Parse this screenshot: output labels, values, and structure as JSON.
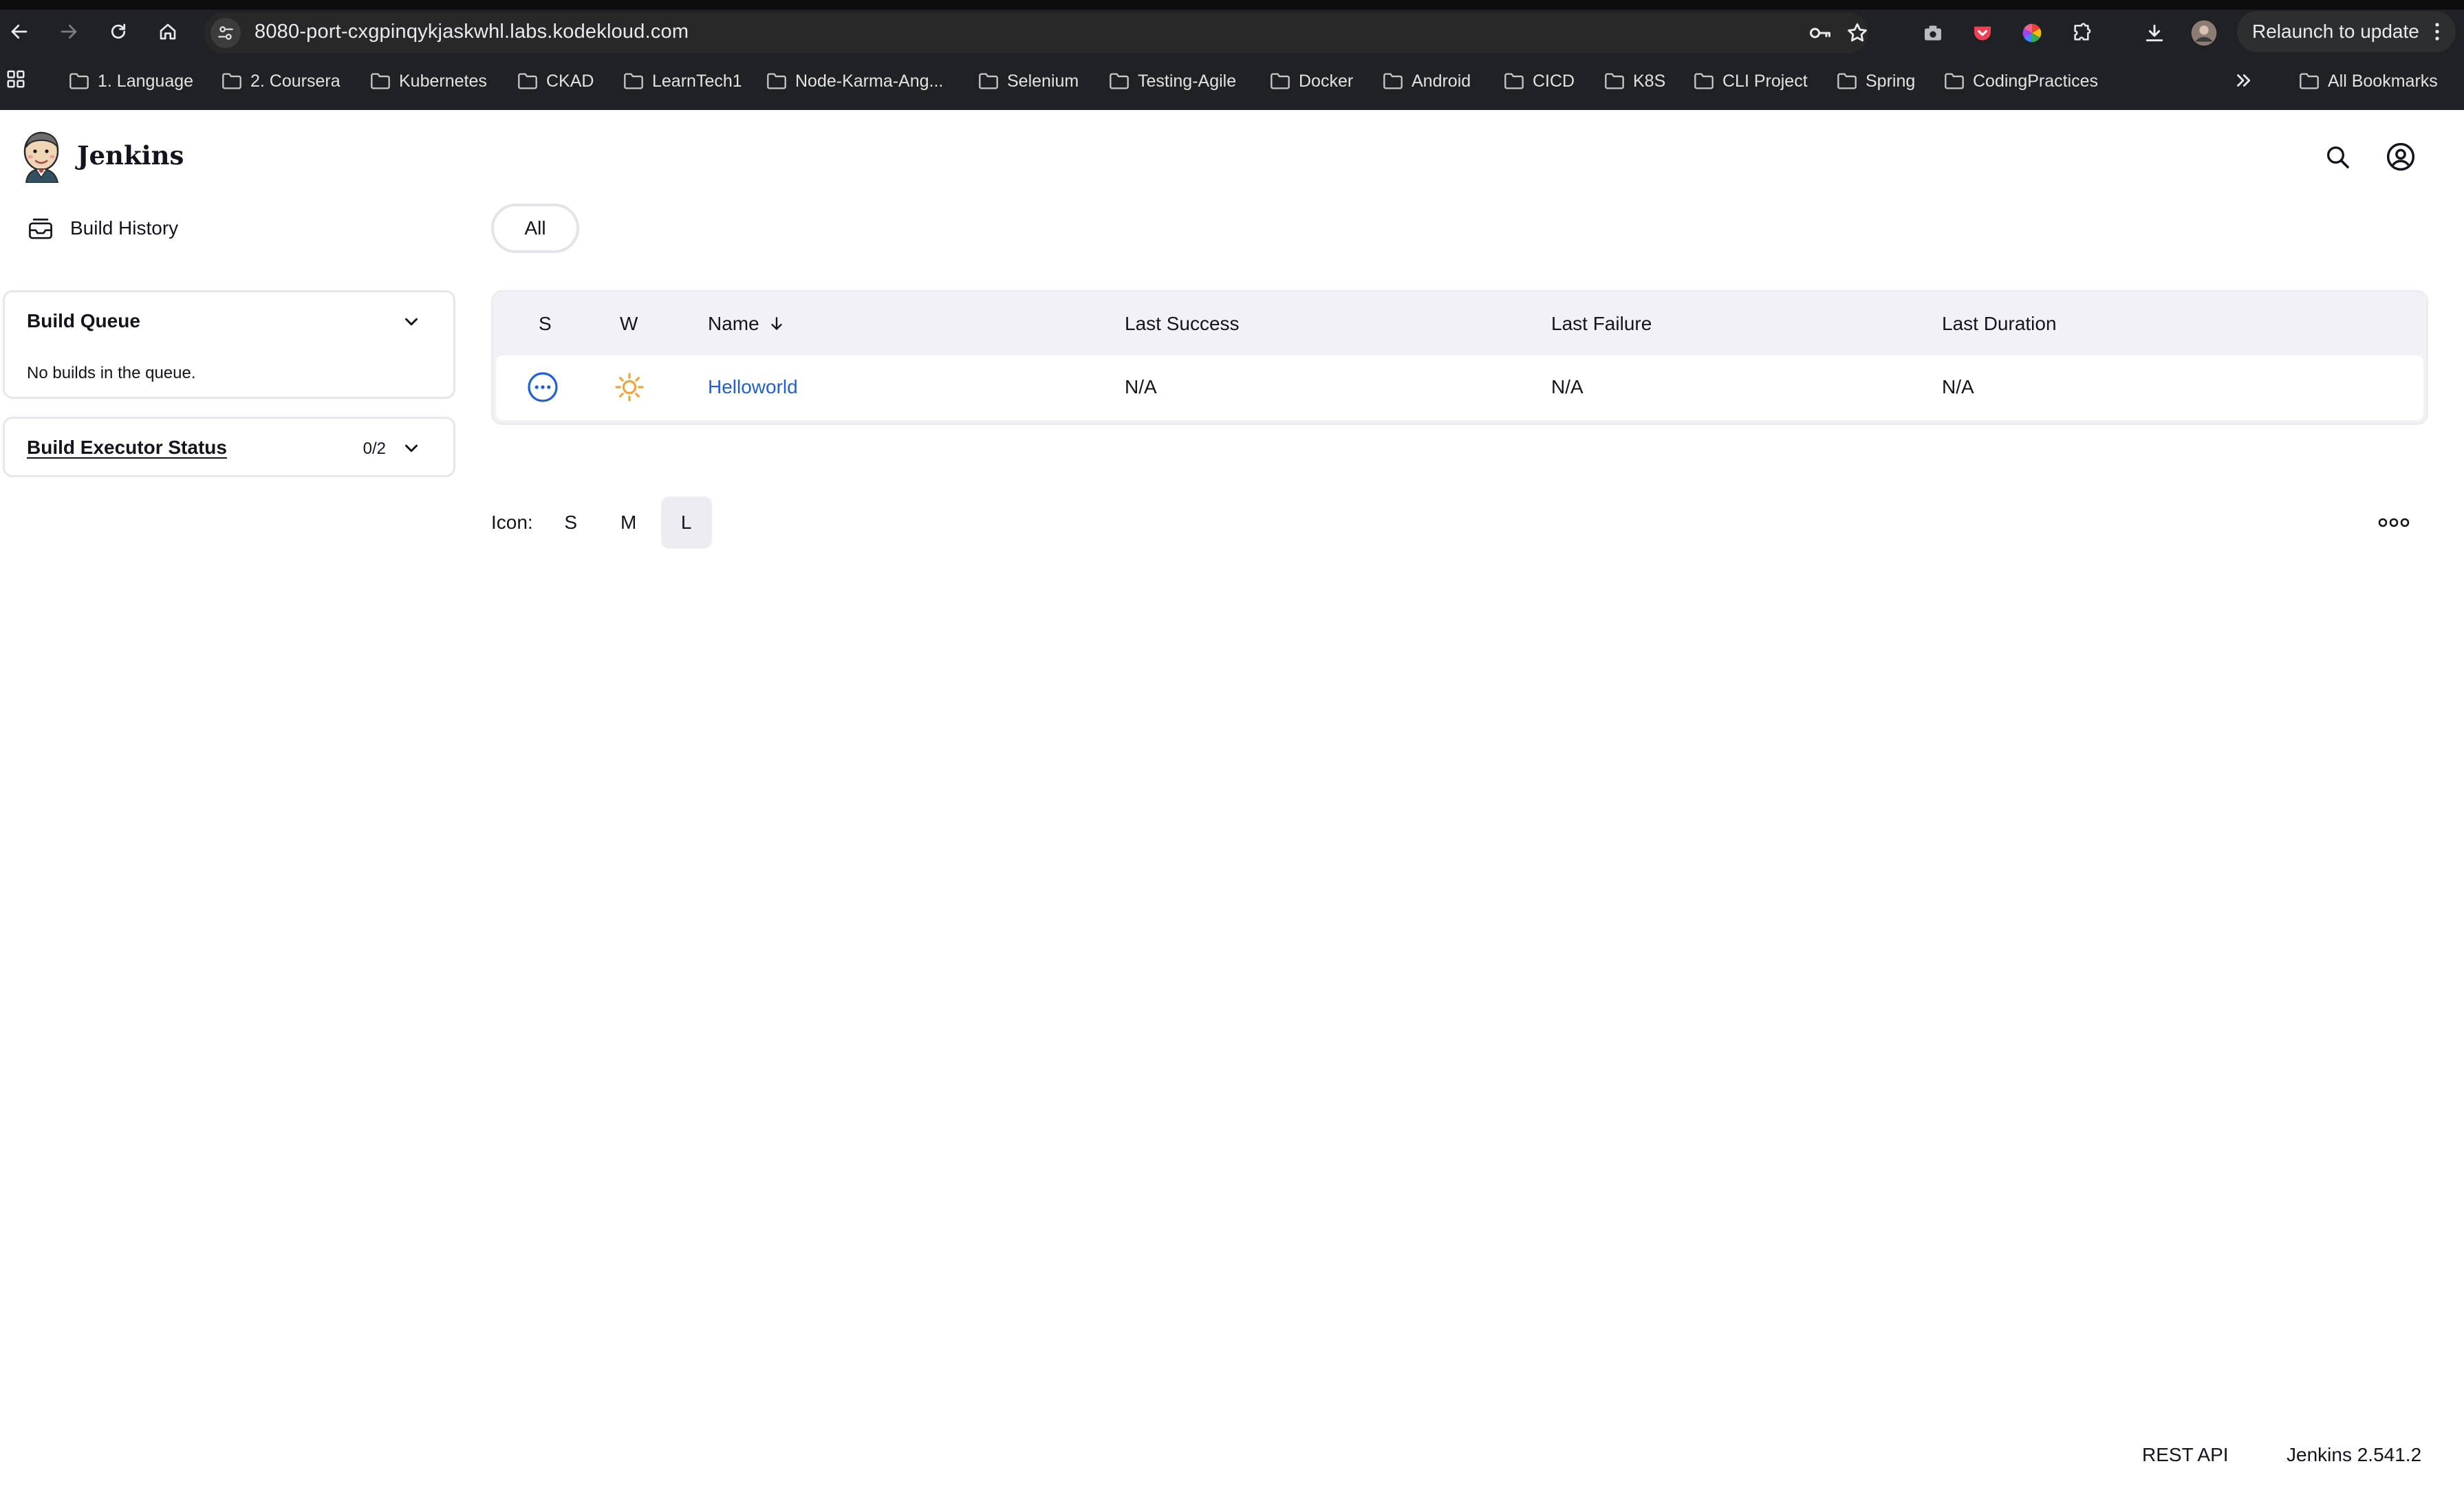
{
  "browser": {
    "url": "8080-port-cxgpinqykjaskwhl.labs.kodekloud.com",
    "relaunch_label": "Relaunch to update",
    "bookmarks": [
      {
        "label": "1. Language"
      },
      {
        "label": "2. Coursera"
      },
      {
        "label": "Kubernetes"
      },
      {
        "label": "CKAD"
      },
      {
        "label": "LearnTech1"
      },
      {
        "label": "Node-Karma-Ang..."
      },
      {
        "label": "Selenium"
      },
      {
        "label": "Testing-Agile"
      },
      {
        "label": "Docker"
      },
      {
        "label": "Android"
      },
      {
        "label": "CICD"
      },
      {
        "label": "K8S"
      },
      {
        "label": "CLI Project"
      },
      {
        "label": "Spring"
      },
      {
        "label": "CodingPractices"
      }
    ],
    "all_bookmarks_label": "All Bookmarks"
  },
  "header": {
    "brand": "Jenkins"
  },
  "sidebar": {
    "build_history_label": "Build History",
    "build_queue": {
      "title": "Build Queue",
      "empty_text": "No builds in the queue."
    },
    "executor_status": {
      "title": "Build Executor Status",
      "count": "0/2"
    }
  },
  "main": {
    "tabs": [
      {
        "label": "All",
        "active": true
      }
    ],
    "table": {
      "headers": {
        "status": "S",
        "weather": "W",
        "name": "Name",
        "last_success": "Last Success",
        "last_failure": "Last Failure",
        "last_duration": "Last Duration"
      },
      "sort_column": "name",
      "rows": [
        {
          "status_icon": "in-progress-icon",
          "weather_icon": "sunny-icon",
          "name": "Helloworld",
          "last_success": "N/A",
          "last_failure": "N/A",
          "last_duration": "N/A"
        }
      ]
    },
    "icon_size": {
      "label": "Icon:",
      "options": [
        "S",
        "M",
        "L"
      ],
      "selected": "L"
    }
  },
  "footer": {
    "rest_api_label": "REST API",
    "version_label": "Jenkins 2.541.2"
  },
  "colors": {
    "link": "#1f5fd8",
    "weather_sun": "#f2a33a",
    "status_running": "#1f5fd8",
    "chrome_background": "#202124"
  }
}
